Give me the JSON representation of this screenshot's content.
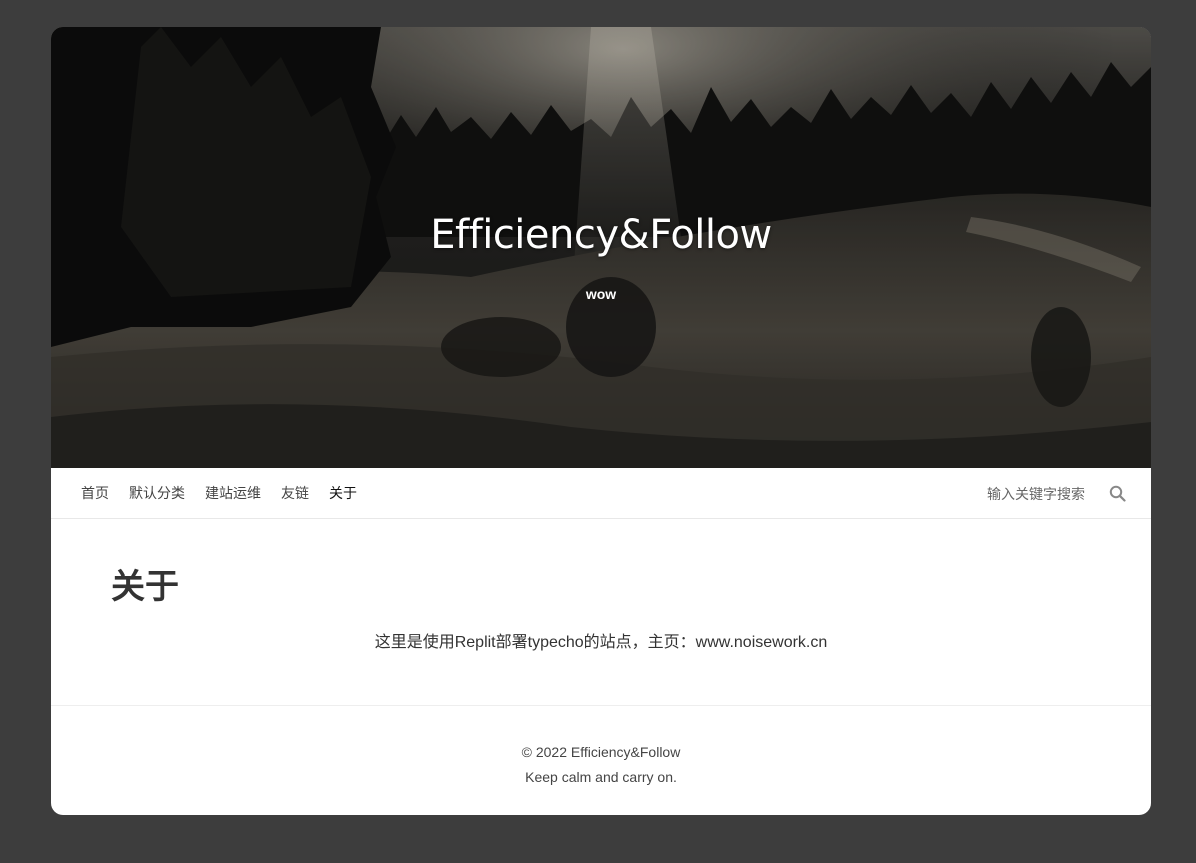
{
  "site": {
    "title": "Efficiency&Follow",
    "description": "wow"
  },
  "nav": {
    "items": [
      {
        "label": "首页"
      },
      {
        "label": "默认分类"
      },
      {
        "label": "建站运维"
      },
      {
        "label": "友链"
      },
      {
        "label": "关于"
      }
    ],
    "current_index": 4
  },
  "search": {
    "placeholder": "输入关键字搜索",
    "icon": "search-icon"
  },
  "page": {
    "title": "关于",
    "body": "这里是使用Replit部署typecho的站点，主页：www.noisework.cn"
  },
  "footer": {
    "copyright": "© 2022 Efficiency&Follow",
    "tagline": "Keep calm and carry on."
  },
  "colors": {
    "background": "#3d3d3d",
    "card": "#ffffff",
    "text": "#333333"
  }
}
